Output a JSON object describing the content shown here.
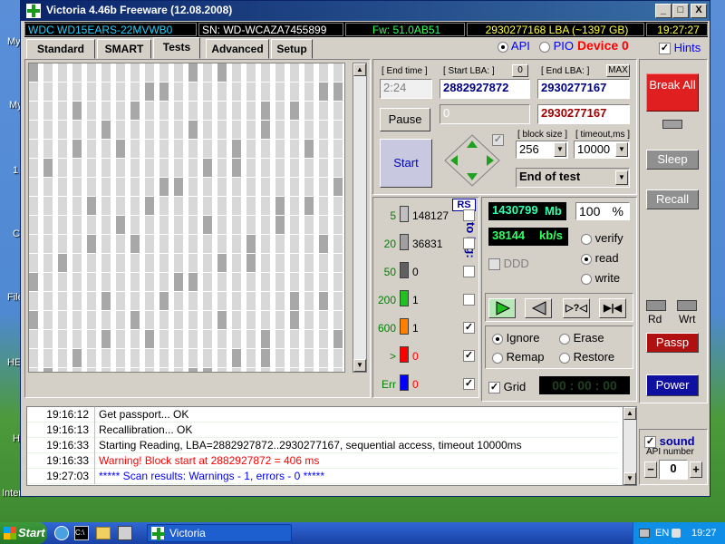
{
  "desktop": {
    "side_labels": [
      "My",
      "My",
      "1",
      "C",
      "File",
      "HE",
      "H",
      "Interner"
    ]
  },
  "window": {
    "title": "Victoria 4.46b Freeware (12.08.2008)",
    "controls": [
      "_",
      "□",
      "X"
    ]
  },
  "infobar": {
    "model": "WDC WD15EARS-22MVWB0",
    "serial": "SN: WD-WCAZA7455899",
    "firmware": "Fw: 51.0AB51",
    "lba": "2930277168 LBA (~1397 GB)",
    "time": "19:27:27"
  },
  "tabs": [
    {
      "label": "Standard",
      "active": false
    },
    {
      "label": "SMART",
      "active": false
    },
    {
      "label": "Tests",
      "active": true
    },
    {
      "label": "Advanced",
      "active": false
    },
    {
      "label": "Setup",
      "active": false
    }
  ],
  "mode": {
    "api": "API",
    "pio": "PIO",
    "device": "Device 0",
    "hints": "Hints"
  },
  "controls": {
    "end_time_label": "[ End time ]",
    "end_time_value": "2:24",
    "start_lba_label": "[ Start LBA: ]",
    "start_lba_zero": "0",
    "start_lba_value": "2882927872",
    "end_lba_label": "[ End LBA: ]",
    "end_lba_max": "MAX",
    "end_lba_value": "2930277167",
    "pause": "Pause",
    "current_lba": "0",
    "current_end": "2930277167",
    "start": "Start",
    "block_size_label": "[ block size ]",
    "block_size_value": "256",
    "timeout_label": "[ timeout,ms ]",
    "timeout_value": "10000",
    "end_action": "End of test"
  },
  "stats": {
    "rs": "RS",
    "to_log": "to log:",
    "rows": [
      {
        "label": "5",
        "count": "148127",
        "color": "#c0c0c0",
        "logged": false
      },
      {
        "label": "20",
        "count": "36831",
        "color": "#a0a0a0",
        "logged": false
      },
      {
        "label": "50",
        "count": "0",
        "color": "#606060",
        "logged": false
      },
      {
        "label": "200",
        "count": "1",
        "color": "#20c020",
        "logged": false
      },
      {
        "label": "600",
        "count": "1",
        "color": "#ff8000",
        "logged": true
      },
      {
        "label": ">",
        "count": "0",
        "color": "#ff0000",
        "logged": true
      },
      {
        "label": "Err",
        "count": "0",
        "color": "#0000ff",
        "logged": true
      }
    ]
  },
  "progress": {
    "mb": "1430799",
    "mb_unit": "Mb",
    "percent": "100",
    "percent_unit": "%",
    "speed": "38144",
    "speed_unit": "kb/s",
    "ddd": "DDD",
    "verify": "verify",
    "read": "read",
    "write": "write"
  },
  "actions": {
    "ignore": "Ignore",
    "erase": "Erase",
    "remap": "Remap",
    "restore": "Restore",
    "grid": "Grid",
    "timer": "00 : 00 : 00"
  },
  "right_panel": {
    "break_all": "Break All",
    "sleep": "Sleep",
    "recall": "Recall",
    "rd": "Rd",
    "wrt": "Wrt",
    "passp": "Passp",
    "power": "Power",
    "sound": "sound",
    "api_number": "API number",
    "api_value": "0"
  },
  "log": [
    {
      "time": "19:16:12",
      "msg": "Get passport... OK",
      "color": "#000000"
    },
    {
      "time": "19:16:13",
      "msg": "Recallibration... OK",
      "color": "#000000"
    },
    {
      "time": "19:16:33",
      "msg": "Starting Reading, LBA=2882927872..2930277167, sequential access, timeout 10000ms",
      "color": "#000000"
    },
    {
      "time": "19:16:33",
      "msg": "Warning! Block start at 2882927872 = 406 ms",
      "color": "#ff0000"
    },
    {
      "time": "19:27:03",
      "msg": "***** Scan results: Warnings - 1, errors - 0 *****",
      "color": "#0000ff"
    }
  ],
  "taskbar": {
    "start": "Start",
    "task": "Victoria",
    "lang": "EN",
    "clock": "19:27"
  }
}
